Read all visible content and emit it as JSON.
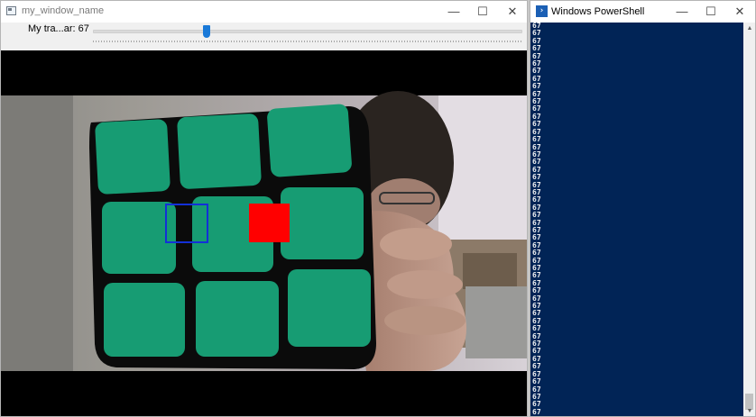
{
  "opencv_window": {
    "title": "my_window_name",
    "trackbar": {
      "label": "My tra...ar: 67",
      "value_fraction": 0.27
    },
    "overlays": {
      "blue_box_color": "#1330d8",
      "red_box_color": "#ff0000"
    }
  },
  "powershell_window": {
    "title": "Windows PowerShell",
    "output_lines": [
      "67",
      "67",
      "67",
      "67",
      "67",
      "67",
      "67",
      "67",
      "67",
      "67",
      "67",
      "67",
      "67",
      "67",
      "67",
      "67",
      "67",
      "67",
      "67",
      "67",
      "67",
      "67",
      "67",
      "67",
      "67",
      "67",
      "67",
      "67",
      "67",
      "67",
      "67",
      "67",
      "67",
      "67",
      "67",
      "67",
      "67",
      "67",
      "67",
      "67",
      "67",
      "67",
      "67",
      "67",
      "67",
      "67",
      "67",
      "67",
      "67",
      "67",
      "67",
      "67"
    ],
    "console_bg": "#012456"
  },
  "icons": {
    "minimize": "minimize-icon",
    "maximize": "maximize-icon",
    "close": "close-icon",
    "app": "opencv-window-icon",
    "powershell": "powershell-icon"
  }
}
